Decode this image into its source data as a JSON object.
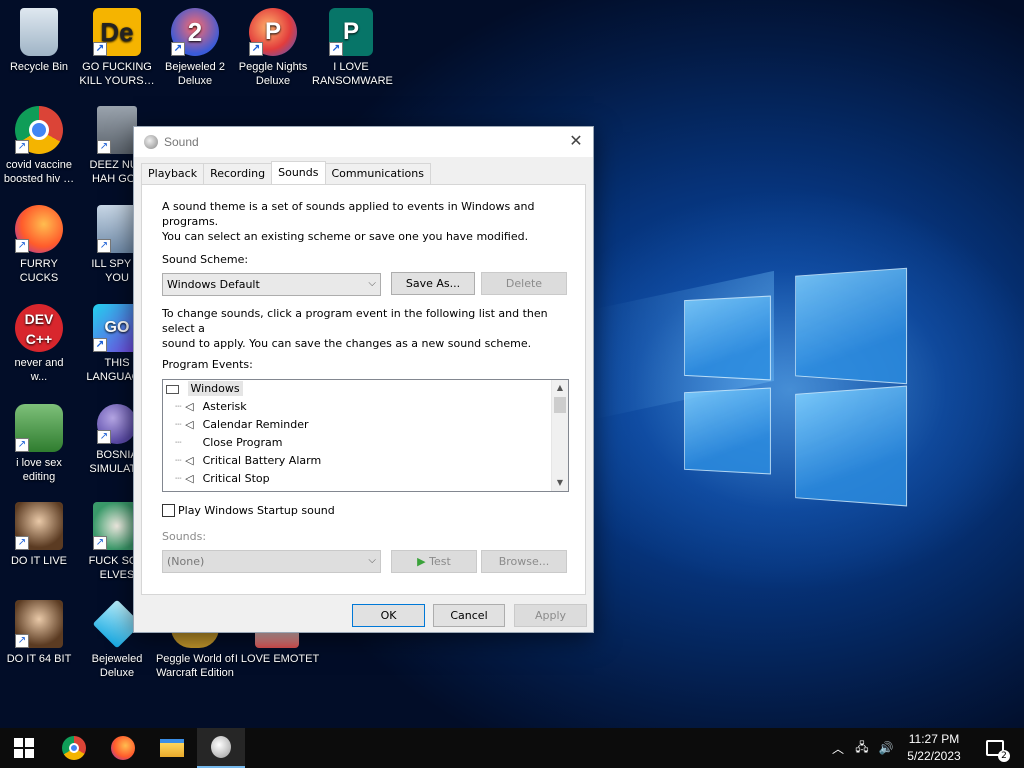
{
  "desktop": {
    "icons": [
      {
        "label": "Recycle Bin"
      },
      {
        "label": "GO FUCKING\nKILL YOURS…"
      },
      {
        "label": "Bejeweled 2\nDeluxe"
      },
      {
        "label": "Peggle Nights\nDeluxe"
      },
      {
        "label": "I LOVE\nRANSOMWARE"
      },
      {
        "label": "covid vaccine\nboosted hiv …"
      },
      {
        "label": "DEEZ NUT\nHAH GOT"
      },
      {
        "label": "FURRY CUCKS"
      },
      {
        "label": "ILL SPY O\nYOU"
      },
      {
        "label": "never and\nw..."
      },
      {
        "label": "THIS\nLANGUAGE"
      },
      {
        "label": "i love sex\nediting"
      },
      {
        "label": "BOSNIA\nSIMULATO"
      },
      {
        "label": "DO IT LIVE"
      },
      {
        "label": "FUCK SON\nELVES"
      },
      {
        "label": "DO IT 64 BIT"
      },
      {
        "label": "Bejeweled\nDeluxe"
      },
      {
        "label": "Peggle World of\nWarcraft Edition"
      },
      {
        "label": "I LOVE EMOTET"
      }
    ]
  },
  "dialog": {
    "title": "Sound",
    "tabs": [
      "Playback",
      "Recording",
      "Sounds",
      "Communications"
    ],
    "active_tab": "Sounds",
    "intro": "A sound theme is a set of sounds applied to events in Windows and programs.\nYou can select an existing scheme or save one you have modified.",
    "scheme_label": "Sound Scheme:",
    "scheme_value": "Windows Default",
    "save_as": "Save As...",
    "delete": "Delete",
    "change_text": "To change sounds, click a program event in the following list and then select a\nsound to apply.  You can save the changes as a new sound scheme.",
    "events_label": "Program Events:",
    "events": [
      {
        "label": "Windows",
        "kind": "group"
      },
      {
        "label": "Asterisk",
        "kind": "sound"
      },
      {
        "label": "Calendar Reminder",
        "kind": "sound"
      },
      {
        "label": "Close Program",
        "kind": "none"
      },
      {
        "label": "Critical Battery Alarm",
        "kind": "sound"
      },
      {
        "label": "Critical Stop",
        "kind": "sound"
      }
    ],
    "startup_label": "Play Windows Startup sound",
    "sounds_label": "Sounds:",
    "sounds_value": "(None)",
    "test": "Test",
    "browse": "Browse...",
    "ok": "OK",
    "cancel": "Cancel",
    "apply": "Apply"
  },
  "taskbar": {
    "time": "11:27 PM",
    "date": "5/22/2023",
    "notifications": "2"
  }
}
